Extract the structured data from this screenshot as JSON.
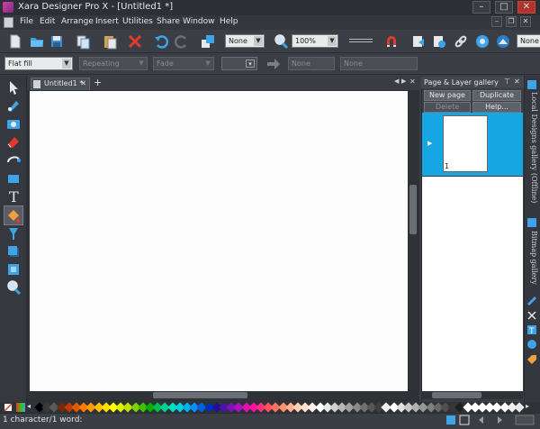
{
  "titlebar": {
    "title": "Xara Designer Pro X - [Untitled1 *]"
  },
  "menu": [
    "File",
    "Edit",
    "Arrange",
    "Insert",
    "Utilities",
    "Share",
    "Window",
    "Help"
  ],
  "toolbar1": {
    "blend_mode": "None",
    "zoom": "100%",
    "right_combo": "None"
  },
  "toolbar2": {
    "fill_type": "Flat fill",
    "repeating": "Repeating",
    "fade": "Fade",
    "none1": "None",
    "none2": "None"
  },
  "document": {
    "tab_label": "Untitled1 *"
  },
  "gallery": {
    "title": "Page & Layer gallery",
    "new_page": "New page",
    "duplicate": "Duplicate",
    "delete": "Delete",
    "help": "Help...",
    "page_number": "1"
  },
  "side_tabs": [
    "Local Designs gallery (Offline)",
    "Bitmap gallery"
  ],
  "status": {
    "text": "1 character/1 word:"
  },
  "colors": {
    "accent": "#17a6e4",
    "palette": [
      "#000000",
      "#3a3a3a",
      "#5a5a5a",
      "#7a2a00",
      "#c23a00",
      "#e05a00",
      "#ff7a00",
      "#ff9a00",
      "#ffbf00",
      "#ffdf00",
      "#ffff00",
      "#e0f000",
      "#bfe000",
      "#7fd000",
      "#3fc000",
      "#00b000",
      "#00c050",
      "#00d090",
      "#00e0c0",
      "#00d0e0",
      "#00b0f0",
      "#0090ff",
      "#0060e0",
      "#0030c0",
      "#2010a0",
      "#5010b0",
      "#8010c0",
      "#b010c0",
      "#e010b0",
      "#ff10a0",
      "#ff3080",
      "#ff5060",
      "#ff7060",
      "#ff9070",
      "#ffb090",
      "#ffd0b0",
      "#ffe0d0",
      "#fff0e8",
      "#ffffff",
      "#e8e8e8",
      "#d0d0d0",
      "#b8b8b8",
      "#a0a0a0",
      "#888888",
      "#707070",
      "#585858",
      "#404040",
      "#f0f0f0",
      "#ffffff",
      "#e0e0e0",
      "#c8c8c8",
      "#b0b0b0",
      "#989898",
      "#808080",
      "#686868",
      "#505050",
      "#383838",
      "#202020",
      "#ffffff",
      "#ffffff",
      "#ffffff",
      "#ffffff",
      "#ffffff",
      "#f8f8f8",
      "#f0f0f0",
      "#e8e8e8"
    ]
  }
}
